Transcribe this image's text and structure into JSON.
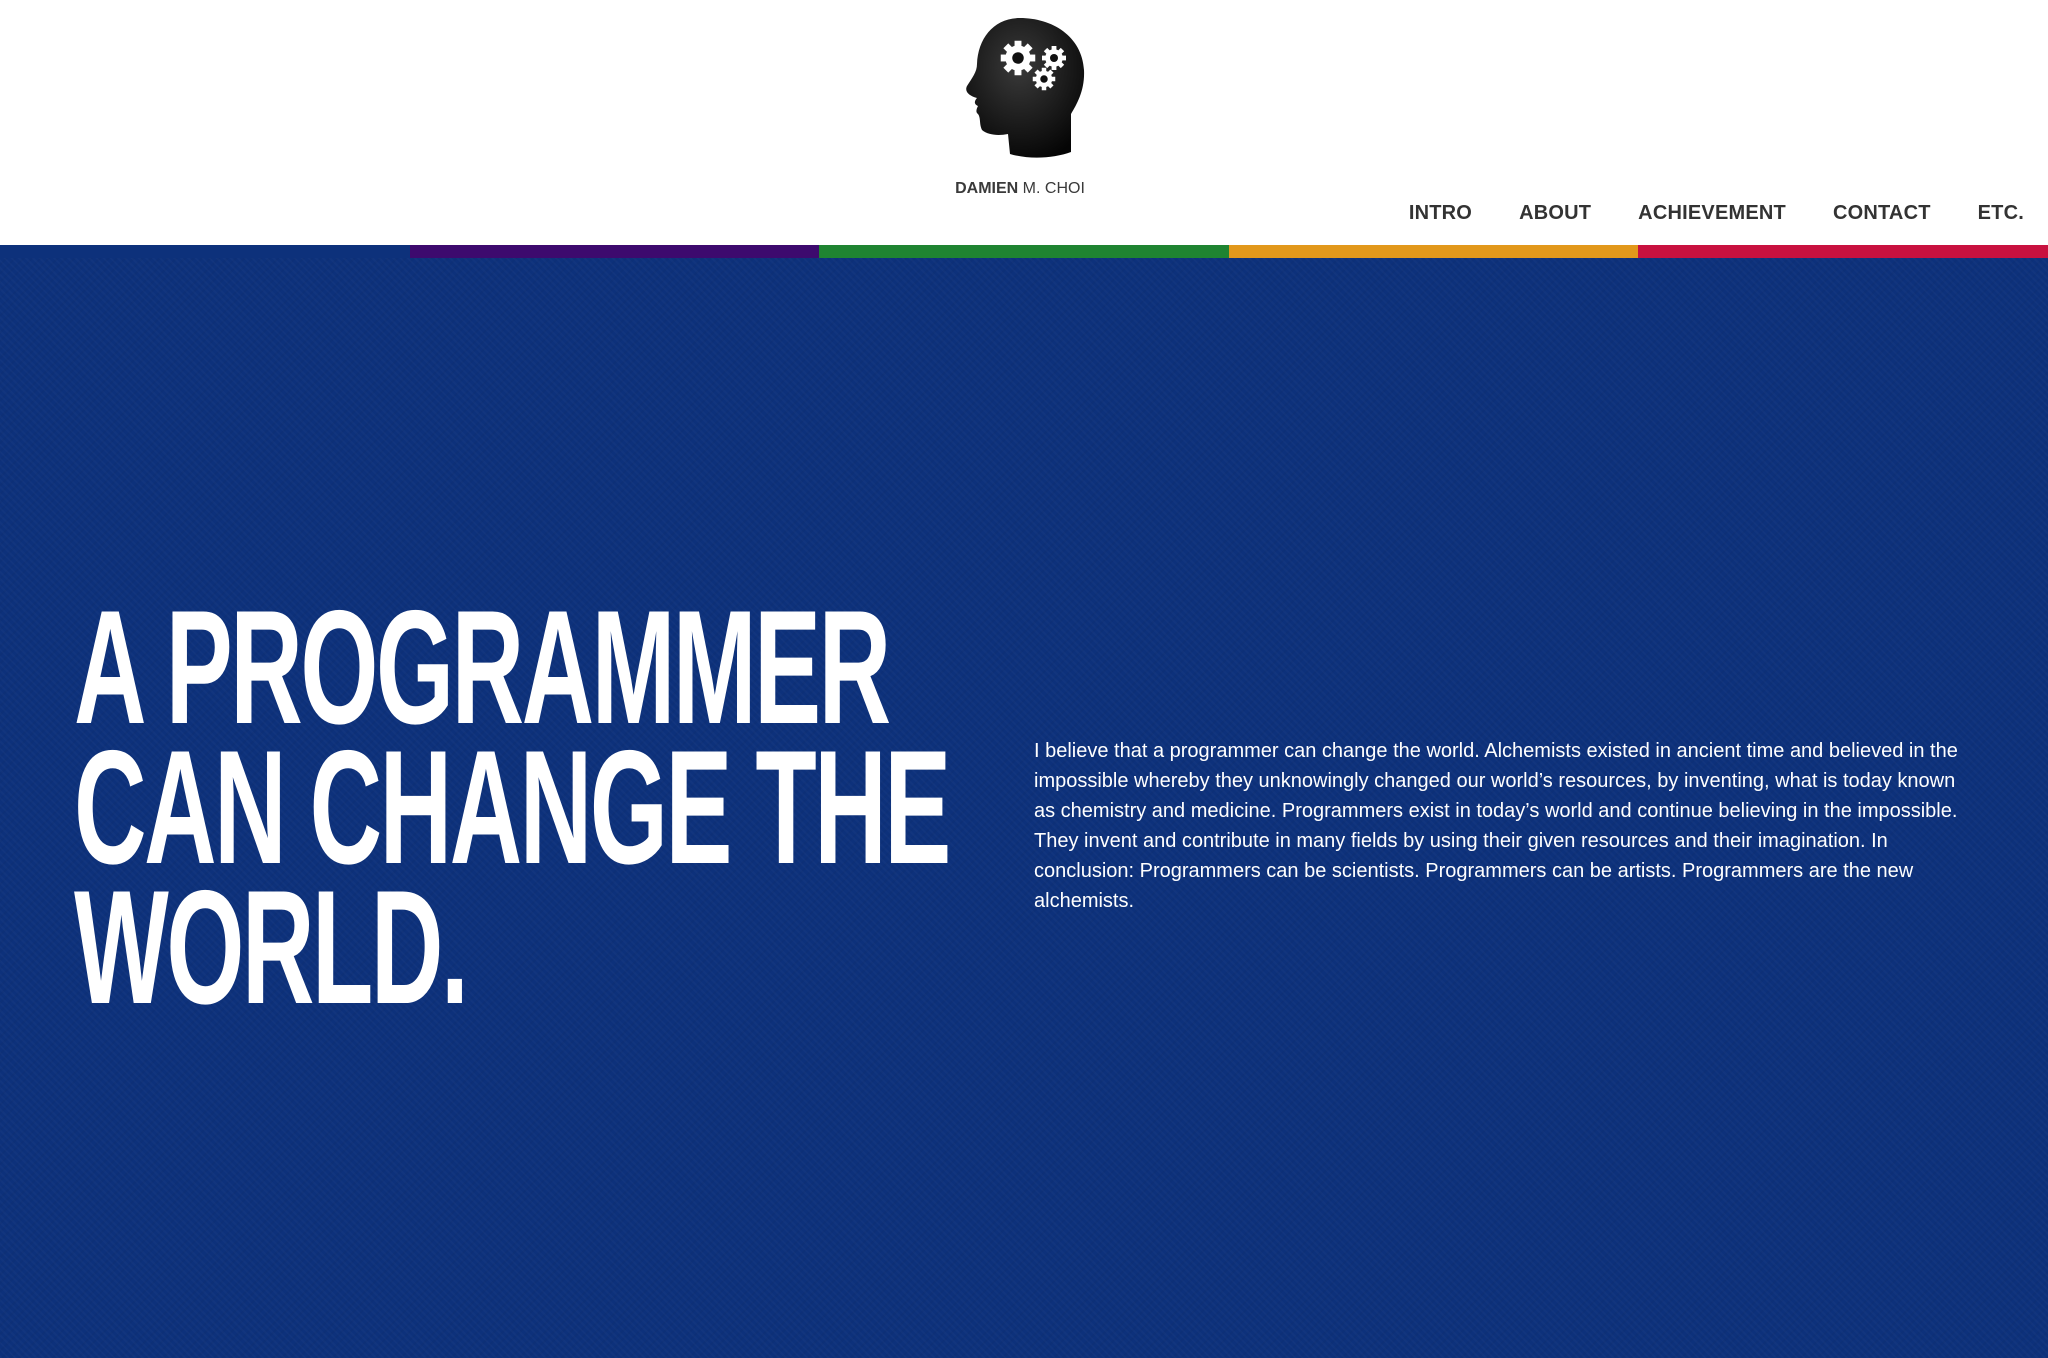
{
  "brand": {
    "name_first": "DAMIEN",
    "name_rest": " M. CHOI",
    "logo_icon": "head-with-gears-icon"
  },
  "nav": {
    "items": [
      {
        "label": "INTRO"
      },
      {
        "label": "ABOUT"
      },
      {
        "label": "ACHIEVEMENT"
      },
      {
        "label": "CONTACT"
      },
      {
        "label": "ETC."
      }
    ]
  },
  "stripe_colors": [
    "#0d317b",
    "#3d0a6e",
    "#1f8431",
    "#e2981b",
    "#c8113f"
  ],
  "hero": {
    "background_color": "#0d317b",
    "headline_lines": [
      "A PROGRAMMER",
      "CAN CHANGE THE",
      "WORLD."
    ],
    "body": "I believe that a programmer can change the world. Alchemists existed in ancient time and believed in the impossible whereby they unknowingly changed our world’s resources, by inventing, what is today known as chemistry and medicine. Programmers exist in today’s world and continue believing in the impossible. They invent and contribute in many fields by using their given resources and their imagination. In conclusion: Programmers can be scientists. Programmers can be artists. Programmers are the new alchemists."
  }
}
